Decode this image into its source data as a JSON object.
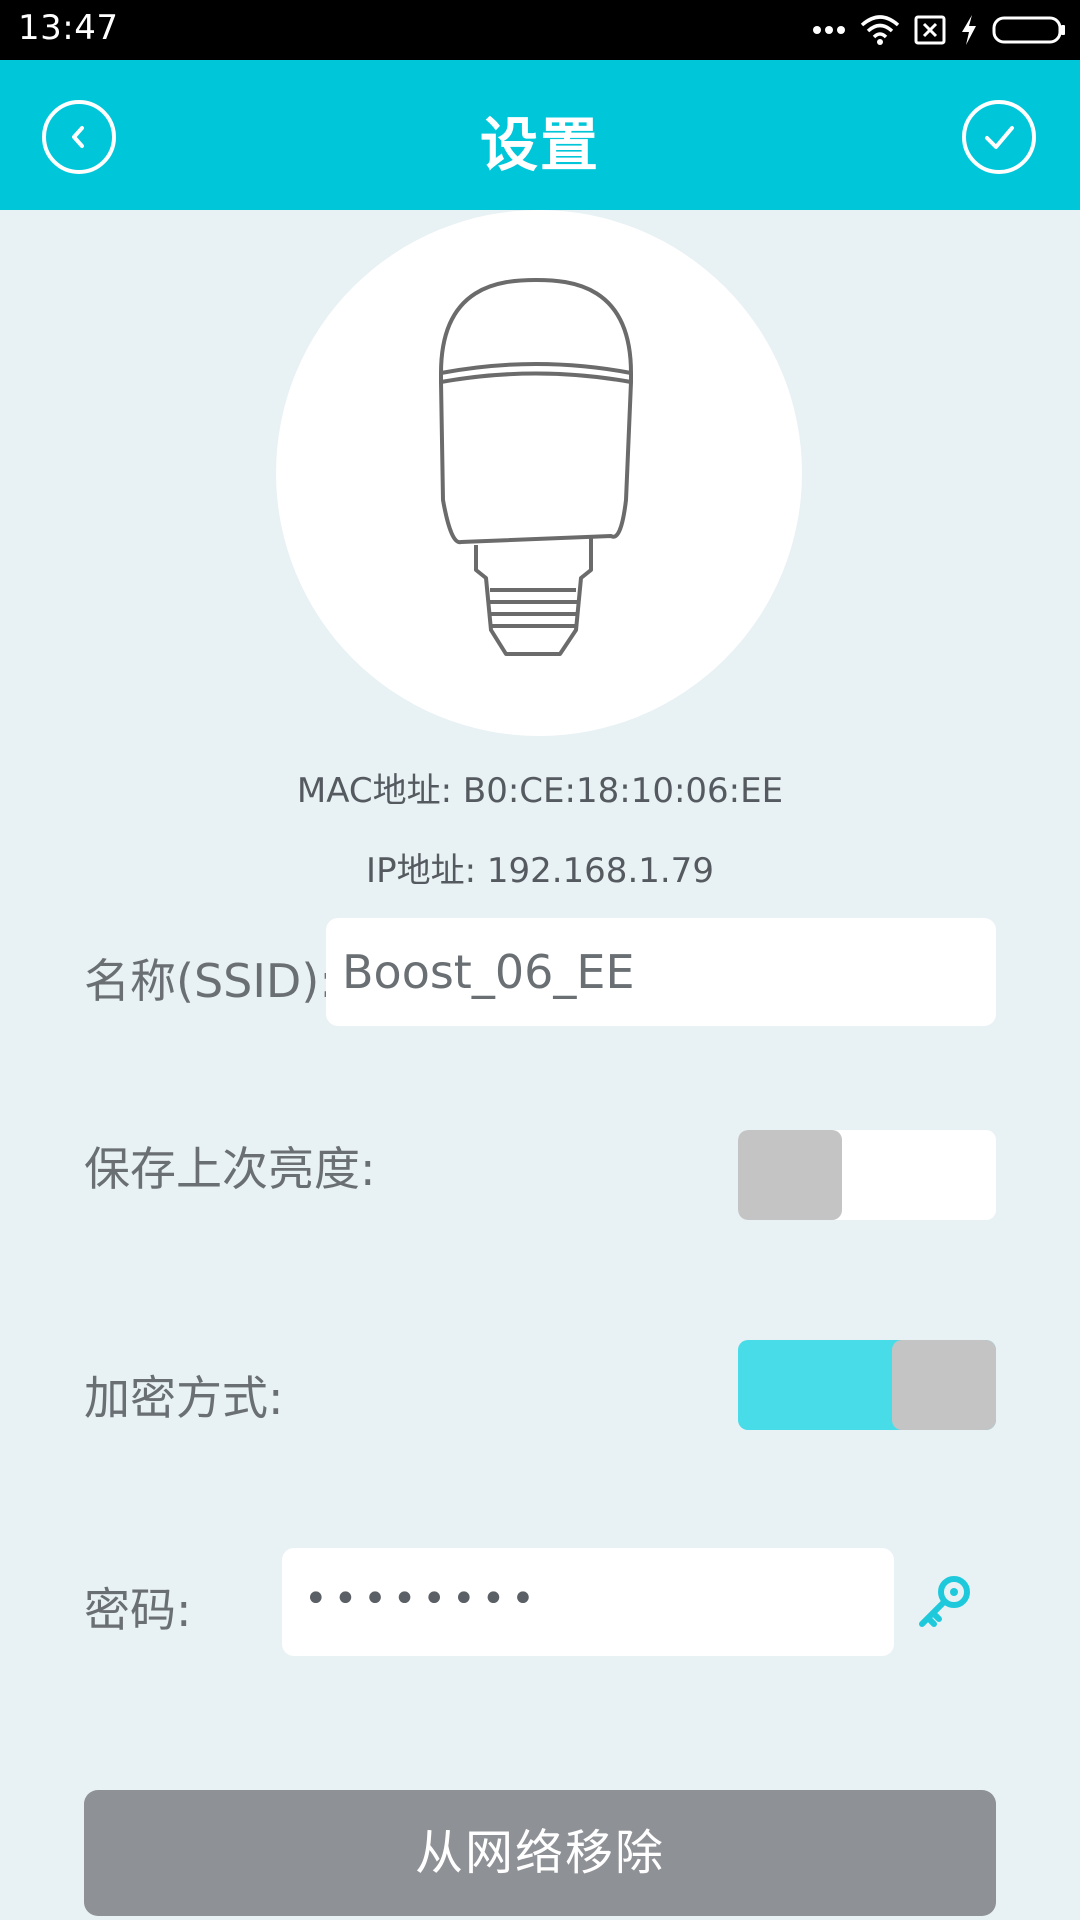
{
  "status_bar": {
    "time": "13:47"
  },
  "app_bar": {
    "title": "设置"
  },
  "device": {
    "mac": "MAC地址:  B0:CE:18:10:06:EE",
    "ip": "IP地址:  192.168.1.79"
  },
  "form": {
    "ssid_label": "名称(SSID):",
    "ssid_value": "Boost_06_EE",
    "save_brightness_label": "保存上次亮度:",
    "save_brightness_on": false,
    "encryption_label": "加密方式:",
    "encryption_on": true,
    "password_label": "密码:",
    "password_masked": "••••••••"
  },
  "actions": {
    "remove_label": "从网络移除"
  },
  "colors": {
    "accent": "#00c6d9",
    "toggle_on": "#48dce8",
    "remove_button": "#8e9196"
  }
}
